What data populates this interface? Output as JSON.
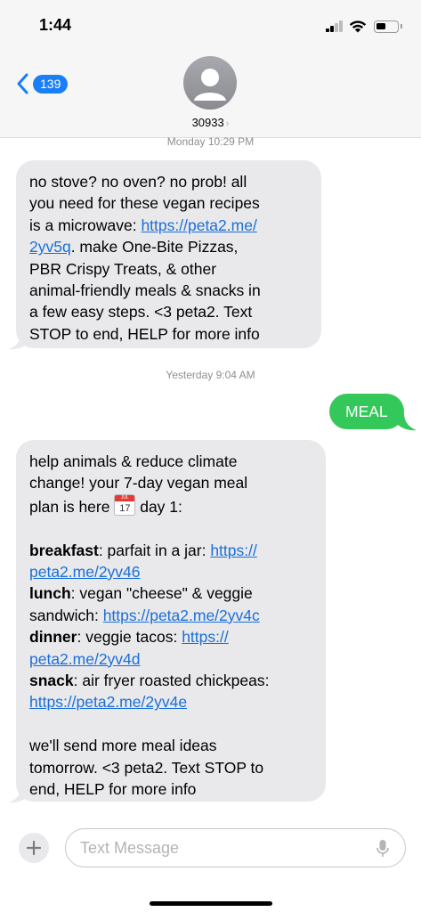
{
  "status_bar": {
    "time": "1:44"
  },
  "header": {
    "back_count": "139",
    "contact_name": "30933",
    "chevron": "›"
  },
  "messages": {
    "ts1": "Monday 10:29 PM",
    "m1": {
      "l1": "no stove? no oven? no prob! all",
      "l2": "you need for these vegan recipes",
      "l3a": "is a microwave: ",
      "l3link": "https://peta2.me/",
      "l4link": "2yv5q",
      "l4b": ". make One-Bite Pizzas,",
      "l5": "PBR Crispy Treats, & other",
      "l6": "animal-friendly meals & snacks in",
      "l7": "a few easy steps. <3 peta2. Text",
      "l8": "STOP to end, HELP for more info"
    },
    "ts2": "Yesterday 9:04 AM",
    "outgoing_text": "MEAL",
    "m2": {
      "l1": "help animals & reduce climate",
      "l2": "change! your 7-day vegan meal",
      "l3a": "plan is here ",
      "cal_month": "JUL",
      "cal_day": "17",
      "l3b": " day 1:",
      "breakfast_label": "breakfast",
      "breakfast_text": ": parfait in a jar: ",
      "breakfast_link1": "https://",
      "breakfast_link2": "peta2.me/2yv46",
      "lunch_label": "lunch",
      "lunch_text": ": vegan \"cheese\" & veggie",
      "lunch_text2": "sandwich: ",
      "lunch_link": "https://peta2.me/2yv4c",
      "dinner_label": "dinner",
      "dinner_text": ": veggie tacos: ",
      "dinner_link1": "https://",
      "dinner_link2": "peta2.me/2yv4d",
      "snack_label": "snack",
      "snack_text": ": air fryer roasted chickpeas:",
      "snack_link": "https://peta2.me/2yv4e",
      "end1": "we'll send more meal ideas",
      "end2": "tomorrow. <3 peta2. Text STOP to",
      "end3": "end, HELP for more info"
    }
  },
  "composer": {
    "placeholder": "Text Message"
  },
  "colors": {
    "accent": "#1a7ef7",
    "incoming_bubble": "#e9e9eb",
    "outgoing_bubble": "#34c759",
    "link": "#1a6fd8"
  },
  "icons": [
    "back-chevron-icon",
    "avatar-person-icon",
    "calendar-emoji-icon",
    "plus-icon",
    "microphone-icon",
    "wifi-icon",
    "signal-icon",
    "battery-icon"
  ]
}
